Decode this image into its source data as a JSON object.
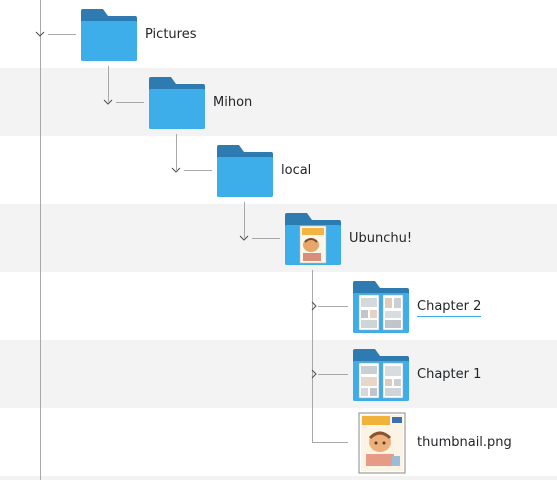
{
  "tree": {
    "items": [
      {
        "name": "Pictures",
        "kind": "folder",
        "expanded": true,
        "icon": "folder-icon"
      },
      {
        "name": "Mihon",
        "kind": "folder",
        "expanded": true,
        "icon": "folder-icon"
      },
      {
        "name": "local",
        "kind": "folder",
        "expanded": true,
        "icon": "folder-icon"
      },
      {
        "name": "Ubunchu!",
        "kind": "folder",
        "expanded": true,
        "icon": "folder-preview-icon"
      },
      {
        "name": "Chapter 2",
        "kind": "folder",
        "expanded": false,
        "current": true,
        "icon": "folder-preview-icon"
      },
      {
        "name": "Chapter 1",
        "kind": "folder",
        "expanded": false,
        "icon": "folder-preview-icon"
      },
      {
        "name": "thumbnail.png",
        "kind": "file",
        "icon": "image-thumbnail-icon"
      }
    ]
  },
  "colors": {
    "folder_back": "#2d7bb0",
    "folder_front": "#3daee9",
    "alternate_row": "#f3f3f3",
    "guide_line": "#a8a8a8",
    "selection_accent": "#3daee9"
  }
}
